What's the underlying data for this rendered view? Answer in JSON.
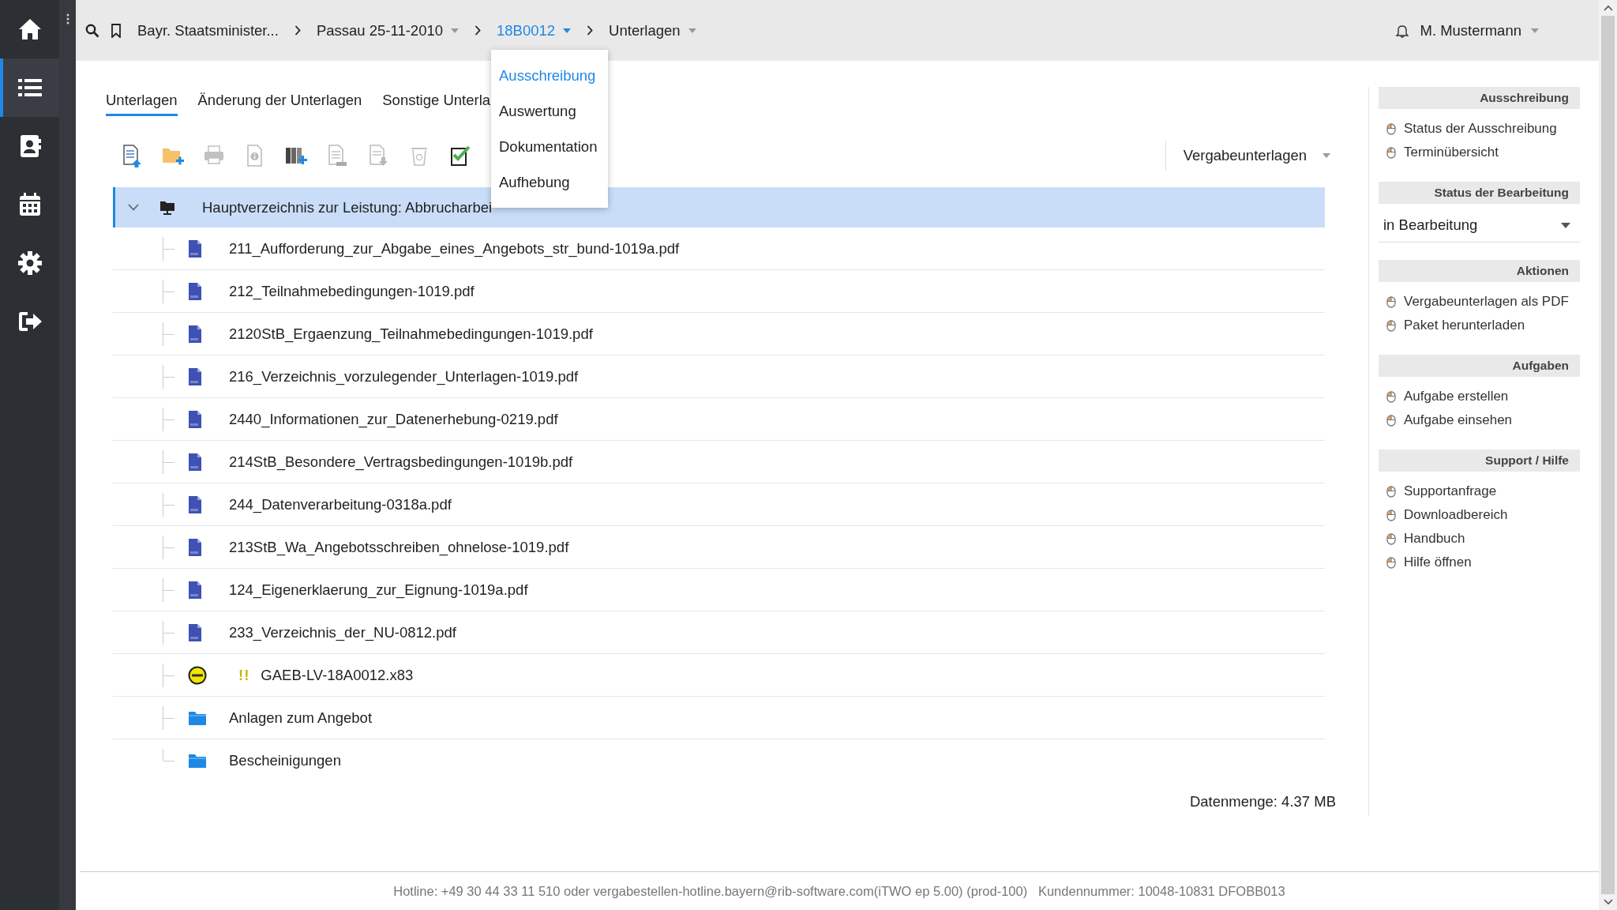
{
  "nav": [
    {
      "kind": "home",
      "selected": false
    },
    {
      "kind": "list",
      "selected": true
    },
    {
      "kind": "contacts",
      "selected": false
    },
    {
      "kind": "calendar",
      "selected": false
    },
    {
      "kind": "settings",
      "selected": false
    },
    {
      "kind": "logout",
      "selected": false
    }
  ],
  "breadcrumb": [
    {
      "label": "Bayr. Staatsminister...",
      "dropdown": false,
      "selected": false
    },
    {
      "label": "Passau 25-11-2010",
      "dropdown": true,
      "selected": false
    },
    {
      "label": "18B0012",
      "dropdown": true,
      "selected": true
    },
    {
      "label": "Unterlagen",
      "dropdown": true,
      "selected": false
    }
  ],
  "breadcrumb_menu": {
    "items": [
      {
        "label": "Ausschreibung",
        "selected": true
      },
      {
        "label": "Auswertung",
        "selected": false
      },
      {
        "label": "Dokumentation",
        "selected": false
      },
      {
        "label": "Aufhebung",
        "selected": false
      }
    ]
  },
  "user": {
    "name": "M. Mustermann"
  },
  "tabs": [
    {
      "label": "Unterlagen",
      "selected": true
    },
    {
      "label": "Änderung der Unterlagen",
      "selected": false
    },
    {
      "label": "Sonstige Unterla",
      "selected": false
    }
  ],
  "toolbar": [
    {
      "kind": "document-upload",
      "disabled": false
    },
    {
      "kind": "folder-add",
      "disabled": false
    },
    {
      "kind": "print",
      "disabled": true
    },
    {
      "kind": "info",
      "disabled": true
    },
    {
      "kind": "binders-add",
      "disabled": false
    },
    {
      "kind": "document-list",
      "disabled": true
    },
    {
      "kind": "document-download",
      "disabled": true
    },
    {
      "kind": "trash",
      "disabled": true
    },
    {
      "kind": "checklist",
      "disabled": false
    }
  ],
  "view_select": {
    "value": "Vergabeunterlagen"
  },
  "tree": {
    "label": "Hauptverzeichnis zur Leistung: Abbrucharbei",
    "expanded": true,
    "selected": true,
    "children": [
      {
        "kind": "pdf",
        "label": "211_Aufforderung_zur_Abgabe_eines_Angebots_str_bund-1019a.pdf"
      },
      {
        "kind": "pdf",
        "label": "212_Teilnahmebedingungen-1019.pdf"
      },
      {
        "kind": "pdf",
        "label": "2120StB_Ergaenzung_Teilnahmebedingungen-1019.pdf"
      },
      {
        "kind": "pdf",
        "label": "216_Verzeichnis_vorzulegender_Unterlagen-1019.pdf"
      },
      {
        "kind": "pdf",
        "label": "2440_Informationen_zur_Datenerhebung-0219.pdf"
      },
      {
        "kind": "pdf",
        "label": "214StB_Besondere_Vertragsbedingungen-1019b.pdf"
      },
      {
        "kind": "pdf",
        "label": "244_Datenverarbeitung-0318a.pdf"
      },
      {
        "kind": "pdf",
        "label": "213StB_Wa_Angebotsschreiben_ohnelose-1019.pdf"
      },
      {
        "kind": "pdf",
        "label": "124_Eigenerklaerung_zur_Eignung-1019a.pdf"
      },
      {
        "kind": "pdf",
        "label": "233_Verzeichnis_der_NU-0812.pdf"
      },
      {
        "kind": "gaeb",
        "label": "GAEB-LV-18A0012.x83",
        "warning": "!!"
      },
      {
        "kind": "folder",
        "label": "Anlagen zum Angebot"
      },
      {
        "kind": "folder",
        "label": "Bescheinigungen"
      }
    ]
  },
  "data_size": "Datenmenge: 4.37 MB",
  "side_panel": [
    {
      "kind": "links",
      "title": "Ausschreibung",
      "items": [
        "Status der Ausschreibung",
        "Terminübersicht"
      ]
    },
    {
      "kind": "select",
      "title": "Status der Bearbeitung",
      "value": "in Bearbeitung"
    },
    {
      "kind": "links",
      "title": "Aktionen",
      "items": [
        "Vergabeunterlagen als PDF",
        "Paket herunterladen"
      ]
    },
    {
      "kind": "links",
      "title": "Aufgaben",
      "items": [
        "Aufgabe erstellen",
        "Aufgabe einsehen"
      ]
    },
    {
      "kind": "links",
      "title": "Support / Hilfe",
      "items": [
        "Supportanfrage",
        "Downloadbereich",
        "Handbuch",
        "Hilfe öffnen"
      ]
    }
  ],
  "footer": "Hotline: +49 30 44 33 11 510 oder vergabestellen-hotline.bayern@rib-software.com(iTWO ep 5.00) (prod-100)   Kundennummer: 10048-10831 DFOBB013"
}
